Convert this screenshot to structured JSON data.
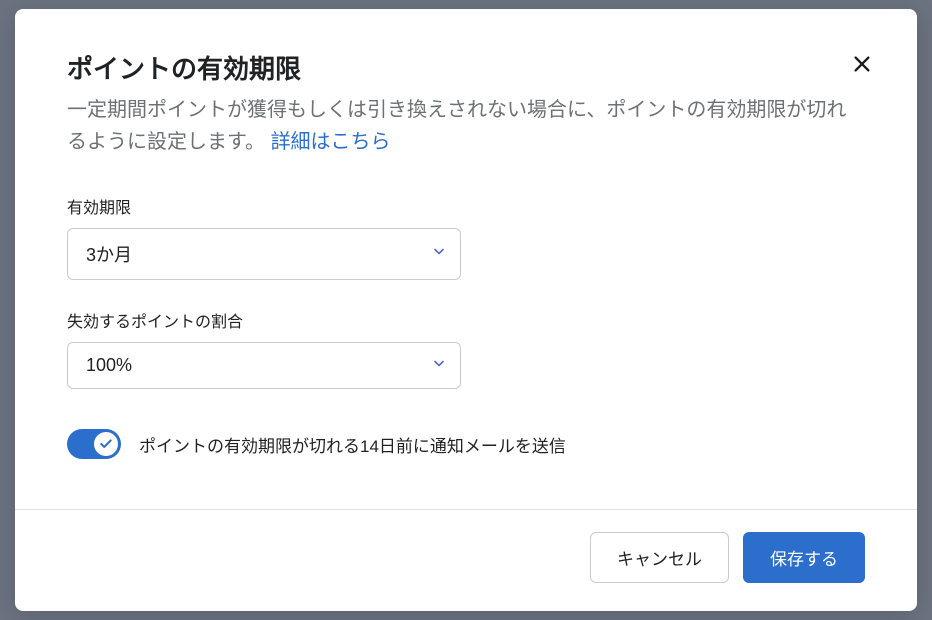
{
  "modal": {
    "title": "ポイントの有効期限",
    "description_before": "一定期間ポイントが獲得もしくは引き換えされない場合に、ポイントの有効期限が切れるように設定します。",
    "link_text": "詳細はこちら"
  },
  "fields": {
    "expiry": {
      "label": "有効期限",
      "value": "3か月"
    },
    "percentage": {
      "label": "失効するポイントの割合",
      "value": "100%"
    }
  },
  "toggle": {
    "enabled": true,
    "label": "ポイントの有効期限が切れる14日前に通知メールを送信"
  },
  "footer": {
    "cancel": "キャンセル",
    "save": "保存する"
  }
}
